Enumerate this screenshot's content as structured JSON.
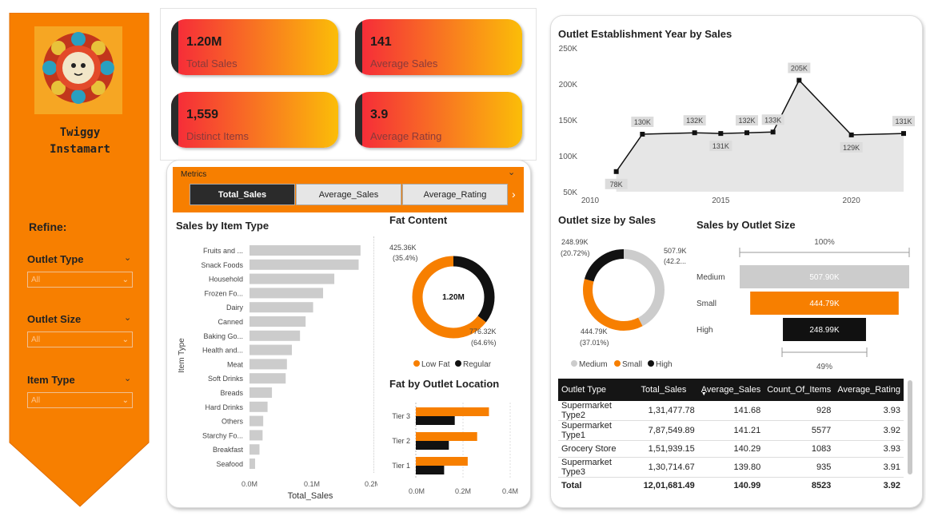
{
  "brand": {
    "line1": "Twiggy",
    "line2": "Instamart"
  },
  "refine_label": "Refine:",
  "filters": [
    {
      "label": "Outlet Type",
      "value": "All"
    },
    {
      "label": "Outlet Size",
      "value": "All"
    },
    {
      "label": "Item Type",
      "value": "All"
    }
  ],
  "kpis": [
    {
      "value": "1.20M",
      "label": "Total Sales"
    },
    {
      "value": "141",
      "label": "Average Sales"
    },
    {
      "value": "1,559",
      "label": "Distinct Items"
    },
    {
      "value": "3.9",
      "label": "Average Rating"
    }
  ],
  "metrics": {
    "title": "Metrics",
    "buttons": [
      "Total_Sales",
      "Average_Sales",
      "Average_Rating"
    ],
    "selected": "Total_Sales"
  },
  "colors": {
    "orange": "#f77f00",
    "black": "#111111",
    "gray": "#cccccc"
  },
  "chart_data": [
    {
      "type": "bar",
      "title": "Sales by Item Type",
      "xlabel": "Total_Sales",
      "ylabel": "Item Type",
      "categories": [
        "Fruits and ...",
        "Snack Foods",
        "Household",
        "Frozen Fo...",
        "Dairy",
        "Canned",
        "Baking Go...",
        "Health and...",
        "Meat",
        "Soft Drinks",
        "Breads",
        "Hard Drinks",
        "Others",
        "Starchy Fo...",
        "Breakfast",
        "Seafood"
      ],
      "values": [
        178000,
        175000,
        136000,
        118000,
        102000,
        90000,
        81000,
        68000,
        60000,
        58000,
        36000,
        29000,
        22000,
        21000,
        16000,
        9000
      ],
      "xticks": [
        "0.0M",
        "0.1M",
        "0.2M"
      ],
      "xlim": [
        0,
        200000
      ]
    },
    {
      "type": "pie",
      "title": "Fat Content",
      "center_label": "1.20M",
      "slices": [
        {
          "name": "Low Fat",
          "value": 776.32,
          "label": "776.32K",
          "pct": "(64.6%)",
          "color": "#f77f00"
        },
        {
          "name": "Regular",
          "value": 425.36,
          "label": "425.36K",
          "pct": "(35.4%)",
          "color": "#111111"
        }
      ]
    },
    {
      "type": "bar",
      "title": "Fat by Outlet Location",
      "categories": [
        "Tier 3",
        "Tier 2",
        "Tier 1"
      ],
      "series": [
        {
          "name": "Low Fat",
          "values": [
            0.31,
            0.26,
            0.22
          ],
          "color": "#f77f00"
        },
        {
          "name": "Regular",
          "values": [
            0.165,
            0.14,
            0.12
          ],
          "color": "#111111"
        }
      ],
      "xticks": [
        "0.0M",
        "0.2M",
        "0.4M"
      ],
      "xlim": [
        0,
        0.4
      ]
    },
    {
      "type": "area",
      "title": "Outlet Establishment Year by Sales",
      "x": [
        2011,
        2012,
        2014,
        2015,
        2016,
        2017,
        2018,
        2020,
        2022
      ],
      "y": [
        78,
        130,
        132,
        131,
        132,
        133,
        205,
        129,
        131
      ],
      "labels": [
        "78K",
        "130K",
        "132K",
        "131K",
        "132K",
        "133K",
        "205K",
        "129K",
        "131K"
      ],
      "yticks": [
        "250K",
        "200K",
        "150K",
        "100K",
        "50K"
      ],
      "xticks": [
        "2010",
        "2015",
        "2020"
      ],
      "ylim": [
        50,
        250
      ],
      "xlim": [
        2010,
        2022
      ]
    },
    {
      "type": "pie",
      "title": "Outlet size by Sales",
      "slices": [
        {
          "name": "Medium",
          "value": 507.9,
          "label": "507.9K",
          "pct": "(42.2...",
          "color": "#cccccc"
        },
        {
          "name": "Small",
          "value": 444.79,
          "label": "444.79K",
          "pct": "(37.01%)",
          "color": "#f77f00"
        },
        {
          "name": "High",
          "value": 248.99,
          "label": "248.99K",
          "pct": "(20.72%)",
          "color": "#111111"
        }
      ]
    },
    {
      "type": "bar",
      "title": "Sales by Outlet Size",
      "categories": [
        "Medium",
        "Small",
        "High"
      ],
      "values": [
        507.9,
        444.79,
        248.99
      ],
      "labels": [
        "507.90K",
        "444.79K",
        "248.99K"
      ],
      "top_pct": "100%",
      "bottom_pct": "49%"
    }
  ],
  "table": {
    "headers": [
      "Outlet Type",
      "Total_Sales",
      "Average_Sales",
      "Count_Of_Items",
      "Average_Rating"
    ],
    "rows": [
      [
        "Supermarket Type2",
        "1,31,477.78",
        "141.68",
        "928",
        "3.93"
      ],
      [
        "Supermarket Type1",
        "7,87,549.89",
        "141.21",
        "5577",
        "3.92"
      ],
      [
        "Grocery Store",
        "1,51,939.15",
        "140.29",
        "1083",
        "3.93"
      ],
      [
        "Supermarket Type3",
        "1,30,714.67",
        "139.80",
        "935",
        "3.91"
      ]
    ],
    "total": [
      "Total",
      "12,01,681.49",
      "140.99",
      "8523",
      "3.92"
    ]
  }
}
